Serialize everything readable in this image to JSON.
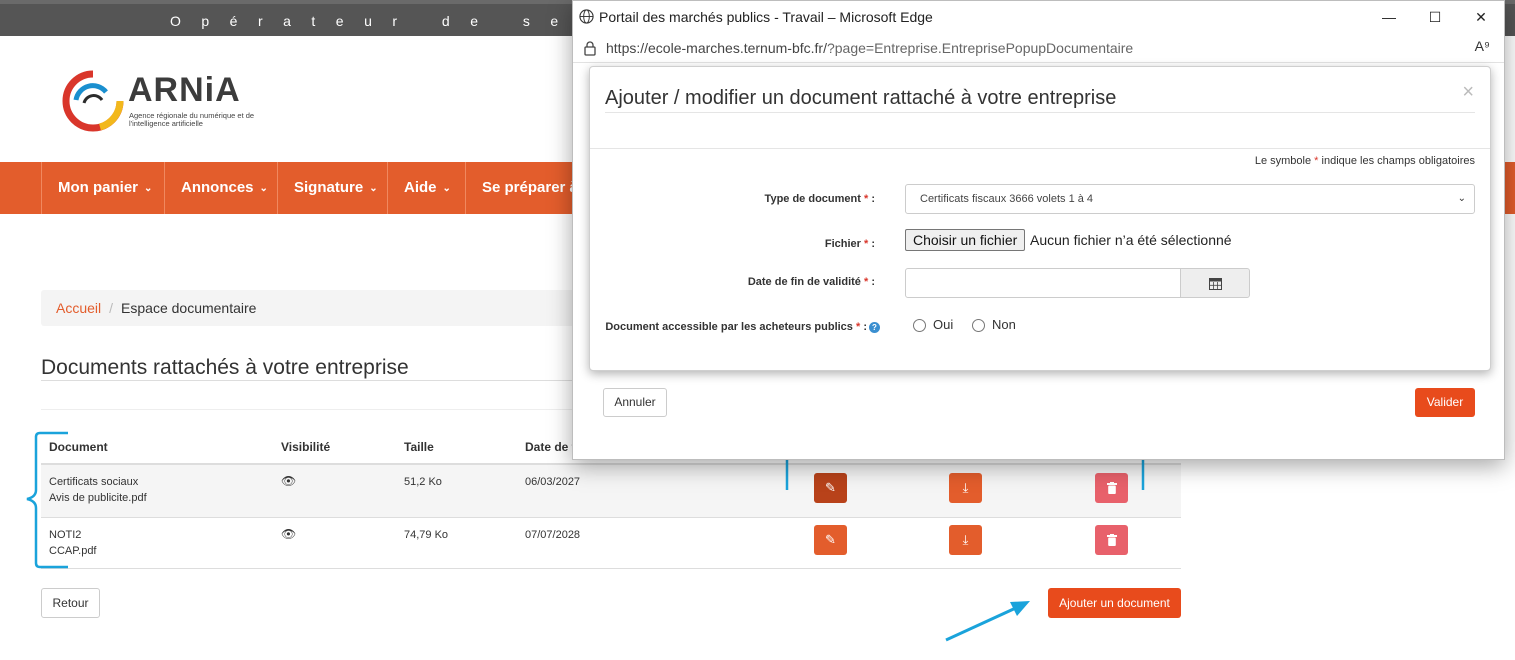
{
  "site": {
    "top_banner": "Opérateur de se",
    "logo_name": "ARNiA",
    "logo_tagline": "Agence régionale du numérique et de l'intelligence artificielle"
  },
  "nav": {
    "items": [
      {
        "label": "Mon panier"
      },
      {
        "label": "Annonces"
      },
      {
        "label": "Signature"
      },
      {
        "label": "Aide"
      },
      {
        "label": "Se préparer à"
      }
    ]
  },
  "breadcrumb": {
    "home": "Accueil",
    "separator": "/",
    "current": "Espace documentaire"
  },
  "page": {
    "title": "Documents rattachés à votre entreprise"
  },
  "table": {
    "headers": {
      "document": "Document",
      "visibility": "Visibilité",
      "size": "Taille",
      "date": "Date de f"
    },
    "rows": [
      {
        "type": "Certificats sociaux",
        "file": "Avis de publicite.pdf",
        "size": "51,2 Ko",
        "date": "06/03/2027"
      },
      {
        "type": "NOTI2",
        "file": "CCAP.pdf",
        "size": "74,79 Ko",
        "date": "07/07/2028"
      }
    ]
  },
  "buttons": {
    "retour": "Retour",
    "add_document": "Ajouter un document"
  },
  "popup": {
    "window_title": "Portail des marchés publics - Travail – Microsoft Edge",
    "url_host": "https://ecole-marches.ternum-bfc.fr/",
    "url_path": "?page=Entreprise.EntreprisePopupDocumentaire",
    "modal": {
      "title": "Ajouter / modifier un document rattaché à votre entreprise",
      "close": "×",
      "required_note_prefix": "Le symbole",
      "required_note_star": "*",
      "required_note_suffix": "indique les champs obligatoires",
      "fields": {
        "doc_type_label": "Type de document",
        "doc_type_value": "Certificats fiscaux 3666 volets 1 à 4",
        "file_label": "Fichier",
        "file_button": "Choisir un fichier",
        "file_status": "Aucun fichier n’a été sélectionné",
        "end_date_label": "Date de fin de validité",
        "accessible_label": "Document accessible par les acheteurs publics",
        "radio_yes": "Oui",
        "radio_no": "Non",
        "star": "*",
        "colon": ":",
        "help": "?"
      },
      "cancel": "Annuler",
      "submit": "Valider"
    }
  },
  "colors": {
    "brand_orange": "#e35d2c",
    "button_orange": "#e84b1c",
    "delete_red": "#e8616b",
    "annotation_blue": "#1aa3db"
  }
}
